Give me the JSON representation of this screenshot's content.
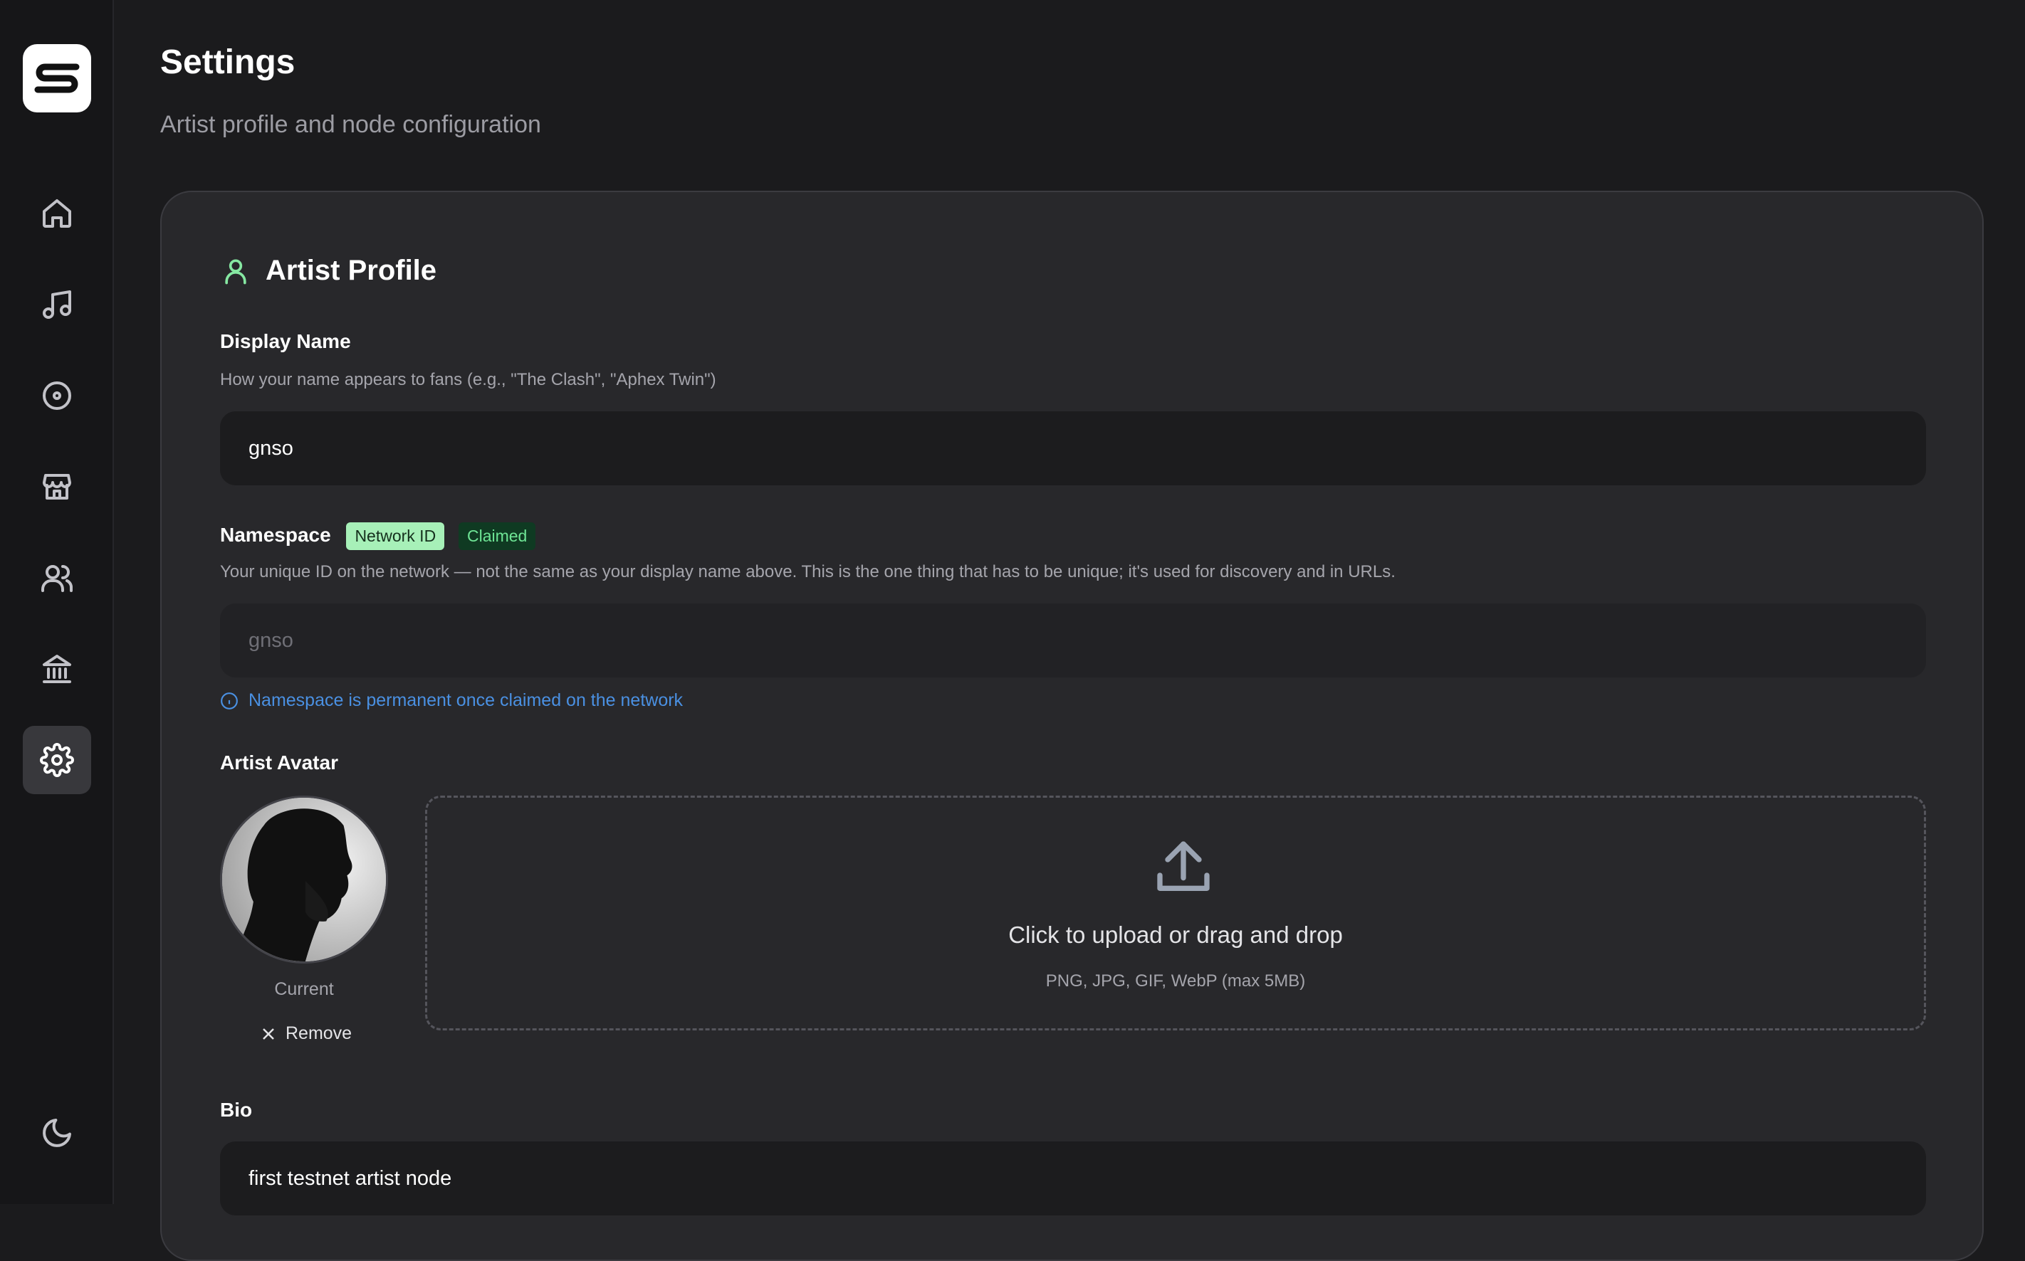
{
  "sidebar": {
    "logo_icon": "s-logo-icon",
    "items": [
      {
        "name": "home",
        "icon": "home-icon",
        "active": false
      },
      {
        "name": "music",
        "icon": "music-note-icon",
        "active": false
      },
      {
        "name": "releases",
        "icon": "disc-icon",
        "active": false
      },
      {
        "name": "store",
        "icon": "store-icon",
        "active": false
      },
      {
        "name": "community",
        "icon": "users-icon",
        "active": false
      },
      {
        "name": "bank",
        "icon": "bank-icon",
        "active": false
      },
      {
        "name": "settings",
        "icon": "gear-icon",
        "active": true
      }
    ],
    "theme_toggle_icon": "moon-icon"
  },
  "header": {
    "title": "Settings",
    "subtitle": "Artist profile and node configuration"
  },
  "artist_profile": {
    "section_title": "Artist Profile",
    "section_icon": "user-icon",
    "display_name": {
      "label": "Display Name",
      "help": "How your name appears to fans (e.g., \"The Clash\", \"Aphex Twin\")",
      "value": "gnso"
    },
    "namespace": {
      "label": "Namespace",
      "badge_network": "Network ID",
      "badge_status": "Claimed",
      "help": "Your unique ID on the network — not the same as your display name above. This is the one thing that has to be unique; it's used for discovery and in URLs.",
      "value": "gnso",
      "note": "Namespace is permanent once claimed on the network"
    },
    "avatar": {
      "label": "Artist Avatar",
      "caption": "Current",
      "remove_label": "Remove",
      "upload_title": "Click to upload or drag and drop",
      "upload_hint": "PNG, JPG, GIF, WebP (max 5MB)"
    },
    "bio": {
      "label": "Bio",
      "value": "first testnet artist node"
    }
  },
  "colors": {
    "accent_green": "#86e8a2",
    "info_blue": "#4a90e2",
    "background": "#1b1b1d",
    "card": "#28282b"
  }
}
